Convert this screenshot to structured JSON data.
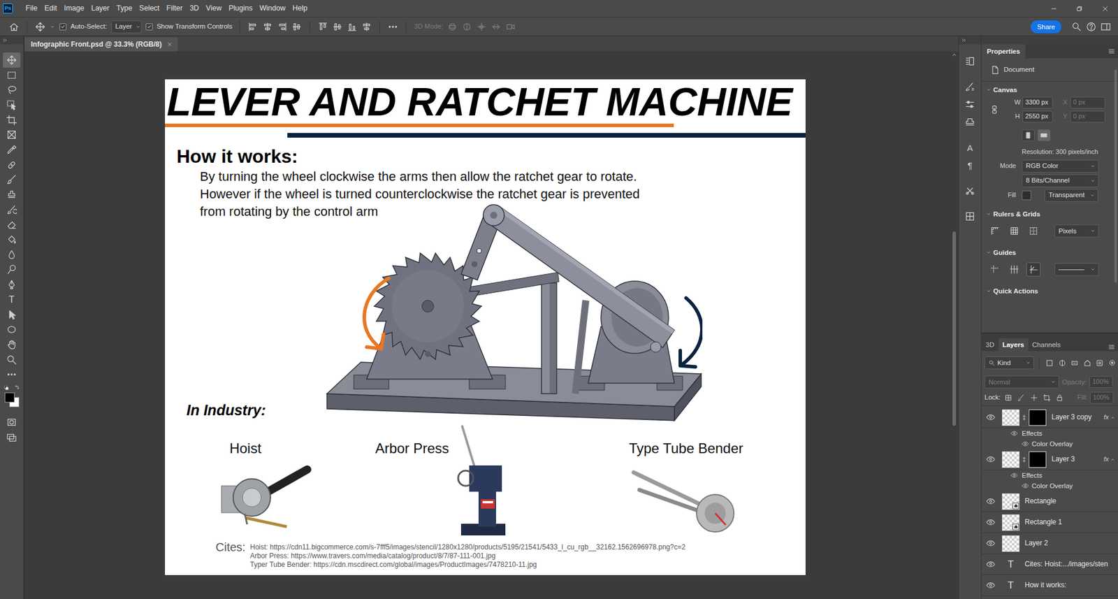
{
  "app": {
    "logo": "Ps",
    "menu": [
      "File",
      "Edit",
      "Image",
      "Layer",
      "Type",
      "Select",
      "Filter",
      "3D",
      "View",
      "Plugins",
      "Window",
      "Help"
    ]
  },
  "options_bar": {
    "auto_select": {
      "label": "Auto-Select:",
      "checked": true
    },
    "target": "Layer",
    "transform_controls": {
      "label": "Show Transform Controls",
      "checked": true
    },
    "mode_3d": {
      "label": "3D Mode:",
      "disabled": true
    },
    "share": "Share"
  },
  "tools": [
    {
      "selected": true
    },
    {
      "selected": false
    },
    {
      "selected": false
    },
    {
      "selected": false
    },
    {
      "selected": false
    },
    {
      "selected": false
    },
    {
      "selected": false
    },
    {
      "selected": false
    },
    {
      "selected": false
    },
    {
      "selected": false
    },
    {
      "selected": false
    },
    {
      "selected": false
    },
    {
      "selected": false
    },
    {
      "selected": false
    },
    {
      "selected": false
    },
    {
      "selected": false
    },
    {
      "selected": false,
      "glyph": "T"
    },
    {
      "selected": false
    },
    {
      "selected": false
    },
    {
      "selected": false
    },
    {
      "selected": false
    },
    {
      "selected": false
    },
    {
      "selected": false
    },
    {
      "selected": false
    }
  ],
  "colors": {
    "foreground": "#000000",
    "background": "#ffffff"
  },
  "document_tab": {
    "title": "Infographic Front.psd @ 33.3% (RGB/8)",
    "selected": true
  },
  "canvas_scroll": {
    "position": 0.32,
    "size": 0.36
  },
  "document": {
    "title": "LEVER AND RATCHET MACHINE",
    "how_heading": "How it works:",
    "how_lines": [
      "By turning the wheel clockwise the arms then allow the ratchet gear to rotate.",
      "However if the wheel is turned counterclockwise the ratchet gear is prevented",
      "from rotating by the control arm"
    ],
    "industry_heading": "In Industry:",
    "industry": [
      {
        "label": "Hoist"
      },
      {
        "label": "Arbor Press"
      },
      {
        "label": "Type Tube Bender"
      }
    ],
    "cites_label": "Cites:",
    "cites": [
      "Hoist: https://cdn11.bigcommerce.com/s-7fff5/images/stencil/1280x1280/products/5195/21541/5433_l_cu_rgb__32162.1562696978.png?c=2",
      "Arbor Press: https://www.travers.com/media/catalog/product/8/7/87-111-001.jpg",
      "Typer Tube Bender: https://cdn.mscdirect.com/global/images/ProductImages/7478210-11.jpg"
    ]
  },
  "side_icons": [
    {},
    {},
    {},
    {},
    {
      "glyph": "A"
    },
    {
      "glyph": "¶"
    },
    {},
    {}
  ],
  "properties": {
    "tab": "Properties",
    "target": "Document",
    "canvas": {
      "heading": "Canvas",
      "expanded": true,
      "fields": [
        {
          "label": "W",
          "value": "3300 px",
          "disabled": false
        },
        {
          "label": "X",
          "value": "0 px",
          "disabled": true
        },
        {
          "label": "H",
          "value": "2550 px",
          "disabled": false
        },
        {
          "label": "Y",
          "value": "0 px",
          "disabled": true
        }
      ],
      "orientation": [
        {
          "selected": false
        },
        {
          "selected": true
        }
      ],
      "resolution": "Resolution: 300 pixels/inch",
      "mode_label": "Mode",
      "mode": "RGB Color",
      "depth": "8 Bits/Channel",
      "fill_label": "Fill",
      "fill": "Transparent"
    },
    "rulers": {
      "heading": "Rulers & Grids",
      "expanded": true,
      "units": "Pixels"
    },
    "guides": {
      "heading": "Guides",
      "expanded": true,
      "toggles": [
        {
          "on": false
        },
        {
          "on": false
        },
        {
          "on": true
        }
      ]
    },
    "quick_actions": {
      "heading": "Quick Actions",
      "expanded": true
    },
    "scroll": {
      "position": 0.04,
      "size": 0.78
    }
  },
  "layers_panel": {
    "tabs": [
      {
        "label": "3D",
        "selected": false
      },
      {
        "label": "Layers",
        "selected": true
      },
      {
        "label": "Channels",
        "selected": false
      }
    ],
    "filter": "Kind",
    "blend": {
      "value": "Normal",
      "disabled": true
    },
    "opacity": {
      "label": "Opacity:",
      "value": "100%",
      "disabled": true
    },
    "lock_label": "Lock:",
    "fill": {
      "label": "Fill:",
      "value": "100%",
      "disabled": true
    },
    "rows": [
      {
        "kind": "layer",
        "name": "Layer 3 copy",
        "visible": true,
        "mask": true,
        "fx": "fx",
        "expanded": true
      },
      {
        "kind": "effects",
        "name": "Effects",
        "visible": true
      },
      {
        "kind": "effect",
        "name": "Color Overlay",
        "visible": true
      },
      {
        "kind": "layer",
        "name": "Layer 3",
        "visible": true,
        "mask": true,
        "fx": "fx",
        "expanded": true
      },
      {
        "kind": "effects",
        "name": "Effects",
        "visible": true
      },
      {
        "kind": "effect",
        "name": "Color Overlay",
        "visible": true
      },
      {
        "kind": "shape",
        "name": "Rectangle",
        "visible": true
      },
      {
        "kind": "shape",
        "name": "Rectangle 1",
        "visible": true
      },
      {
        "kind": "layer",
        "name": "Layer 2",
        "visible": true,
        "mask": false
      },
      {
        "kind": "text",
        "name": "Cites: Hoist:.../images/sten",
        "visible": true,
        "thumb": "T"
      },
      {
        "kind": "text",
        "name": "How it works:",
        "visible": true,
        "thumb": "T"
      }
    ]
  }
}
